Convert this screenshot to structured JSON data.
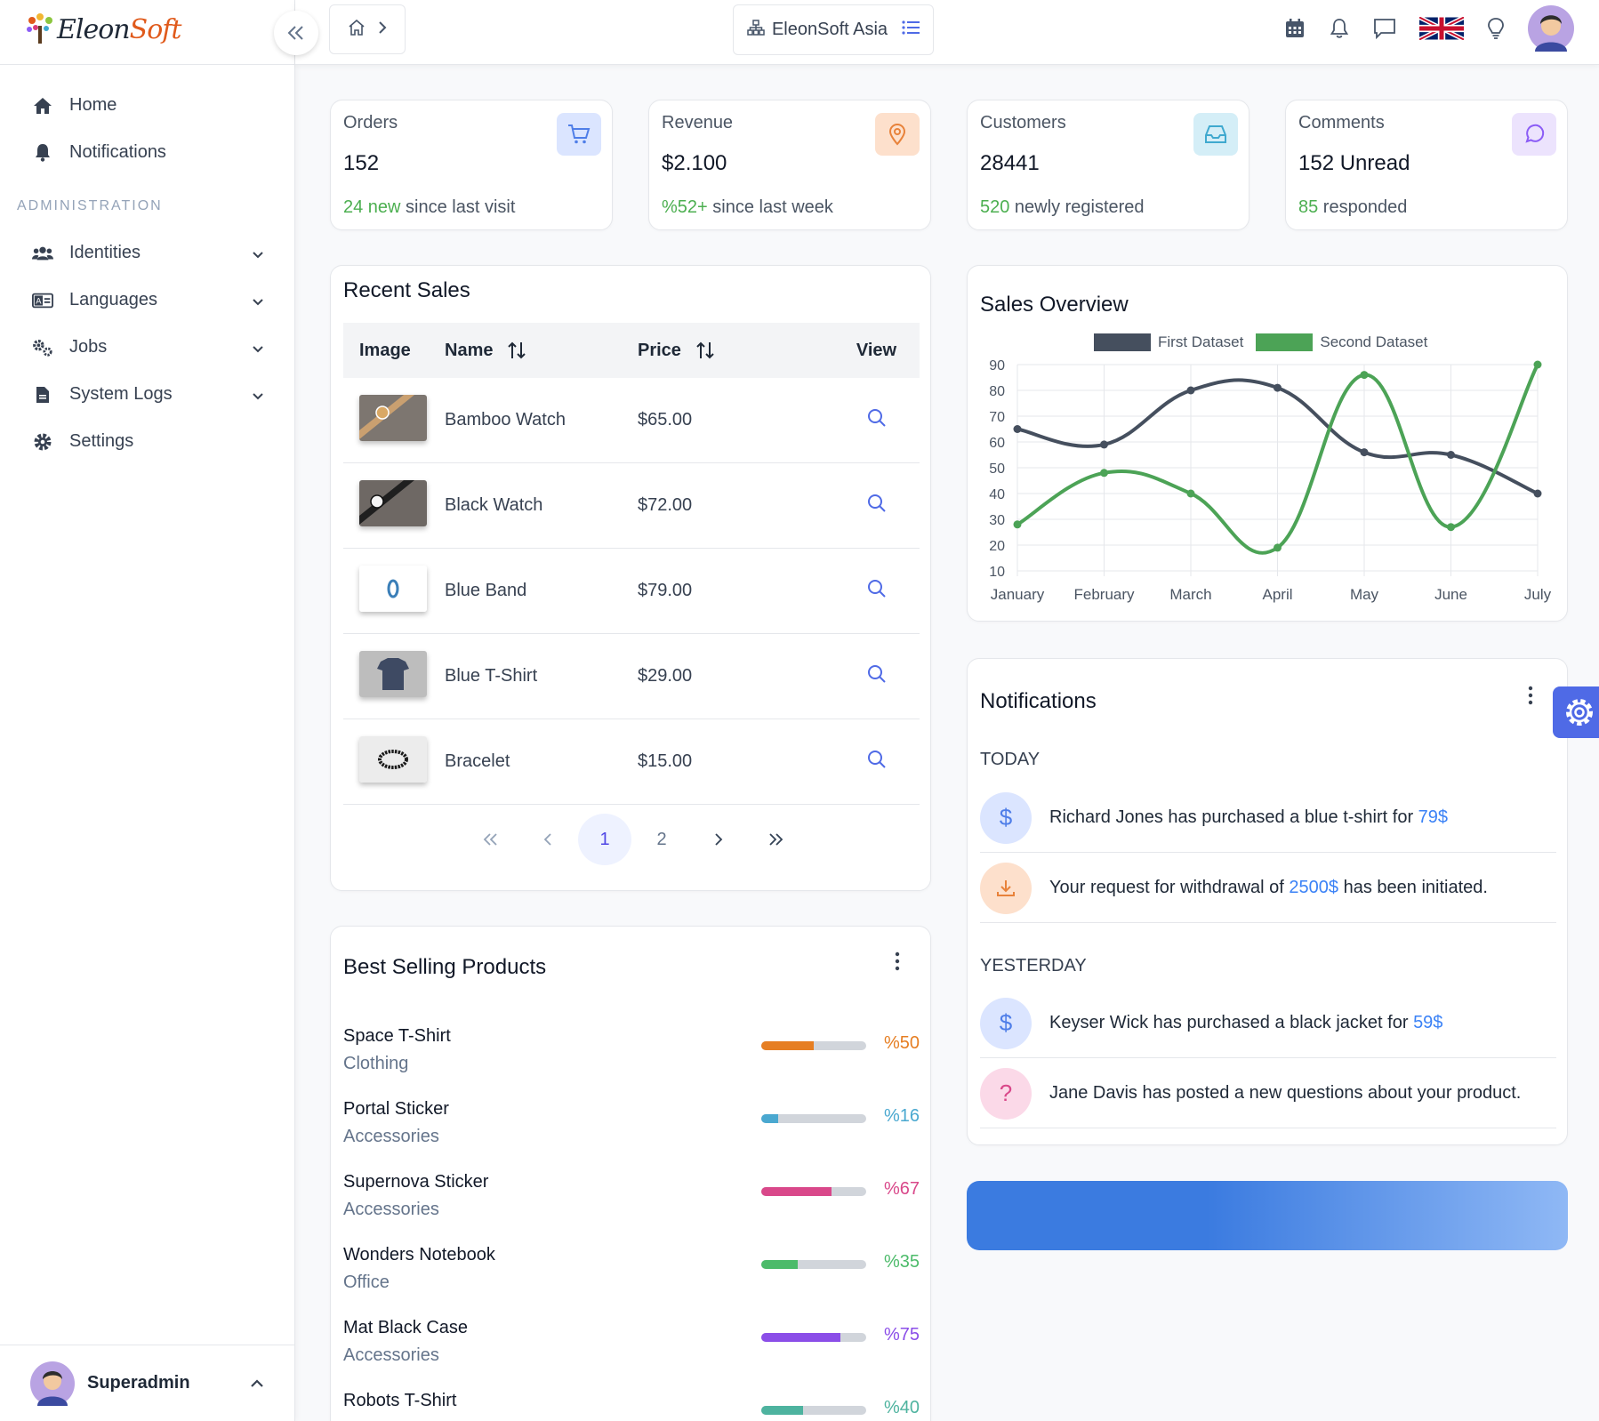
{
  "sidebar": {
    "logo": {
      "part1": "Eleon",
      "part2": "Soft"
    },
    "items": [
      {
        "label": "Home",
        "icon": "home-icon"
      },
      {
        "label": "Notifications",
        "icon": "bell-icon"
      }
    ],
    "section_label": "ADMINISTRATION",
    "admin_items": [
      {
        "label": "Identities",
        "icon": "users-icon"
      },
      {
        "label": "Languages",
        "icon": "language-icon"
      },
      {
        "label": "Jobs",
        "icon": "cogs-icon"
      },
      {
        "label": "System Logs",
        "icon": "file-icon"
      },
      {
        "label": "Settings",
        "icon": "gear-icon"
      }
    ],
    "user": {
      "name": "Superadmin"
    }
  },
  "topbar": {
    "tenant": "EleonSoft Asia"
  },
  "stats": [
    {
      "label": "Orders",
      "value": "152",
      "highlight": "24 new",
      "sub": " since last visit",
      "icon": "cart-icon",
      "badge_bg": "#dbe5ff",
      "icon_color": "#4f7ee8"
    },
    {
      "label": "Revenue",
      "value": "$2.100",
      "highlight": "%52+",
      "sub": " since last week",
      "icon": "map-pin-icon",
      "badge_bg": "#fde0cc",
      "icon_color": "#e8823a"
    },
    {
      "label": "Customers",
      "value": "28441",
      "highlight": "520",
      "sub": " newly registered",
      "icon": "inbox-icon",
      "badge_bg": "#d4eef7",
      "icon_color": "#3fa9cf"
    },
    {
      "label": "Comments",
      "value": "152 Unread",
      "highlight": "85",
      "sub": " responded",
      "icon": "comment-icon",
      "badge_bg": "#ece3fd",
      "icon_color": "#8b5cf6"
    }
  ],
  "recent_sales": {
    "title": "Recent Sales",
    "headers": {
      "image": "Image",
      "name": "Name",
      "price": "Price",
      "view": "View"
    },
    "rows": [
      {
        "name": "Bamboo Watch",
        "price": "$65.00"
      },
      {
        "name": "Black Watch",
        "price": "$72.00"
      },
      {
        "name": "Blue Band",
        "price": "$79.00"
      },
      {
        "name": "Blue T-Shirt",
        "price": "$29.00"
      },
      {
        "name": "Bracelet",
        "price": "$15.00"
      }
    ],
    "pages": [
      "1",
      "2"
    ],
    "current_page": "1"
  },
  "best_selling": {
    "title": "Best Selling Products",
    "items": [
      {
        "name": "Space T-Shirt",
        "category": "Clothing",
        "percent": 50,
        "label": "%50",
        "color": "#e67e22"
      },
      {
        "name": "Portal Sticker",
        "category": "Accessories",
        "percent": 16,
        "label": "%16",
        "color": "#4aa8d0"
      },
      {
        "name": "Supernova Sticker",
        "category": "Accessories",
        "percent": 67,
        "label": "%67",
        "color": "#d9488a"
      },
      {
        "name": "Wonders Notebook",
        "category": "Office",
        "percent": 35,
        "label": "%35",
        "color": "#4cbb6a"
      },
      {
        "name": "Mat Black Case",
        "category": "Accessories",
        "percent": 75,
        "label": "%75",
        "color": "#8b4ee8"
      },
      {
        "name": "Robots T-Shirt",
        "category": "",
        "percent": 40,
        "label": "%40",
        "color": "#4eb39f"
      }
    ]
  },
  "chart_data": {
    "type": "line",
    "title": "Sales Overview",
    "x": [
      "January",
      "February",
      "March",
      "April",
      "May",
      "June",
      "July"
    ],
    "series": [
      {
        "name": "First Dataset",
        "values": [
          65,
          59,
          80,
          81,
          56,
          55,
          40
        ],
        "color": "#454f5e"
      },
      {
        "name": "Second Dataset",
        "values": [
          28,
          48,
          40,
          19,
          86,
          27,
          90
        ],
        "color": "#4ca356"
      }
    ],
    "yticks": [
      10,
      20,
      30,
      40,
      50,
      60,
      70,
      80,
      90
    ],
    "ylim": [
      10,
      90
    ],
    "legend": "top",
    "grid": true
  },
  "notifications": {
    "title": "Notifications",
    "groups": [
      {
        "day": "TODAY",
        "items": [
          {
            "pre": "Richard Jones has purchased a blue t-shirt for ",
            "amount": "79$",
            "post": "",
            "icon": "dollar-icon"
          },
          {
            "pre": "Your request for withdrawal of ",
            "amount": "2500$",
            "post": " has been initiated.",
            "icon": "download-icon"
          }
        ]
      },
      {
        "day": "YESTERDAY",
        "items": [
          {
            "pre": "Keyser Wick has purchased a black jacket for ",
            "amount": "59$",
            "post": "",
            "icon": "dollar-icon"
          },
          {
            "pre": "Jane Davis has posted a new questions about your product.",
            "amount": "",
            "post": "",
            "icon": "question-icon"
          }
        ]
      }
    ]
  }
}
